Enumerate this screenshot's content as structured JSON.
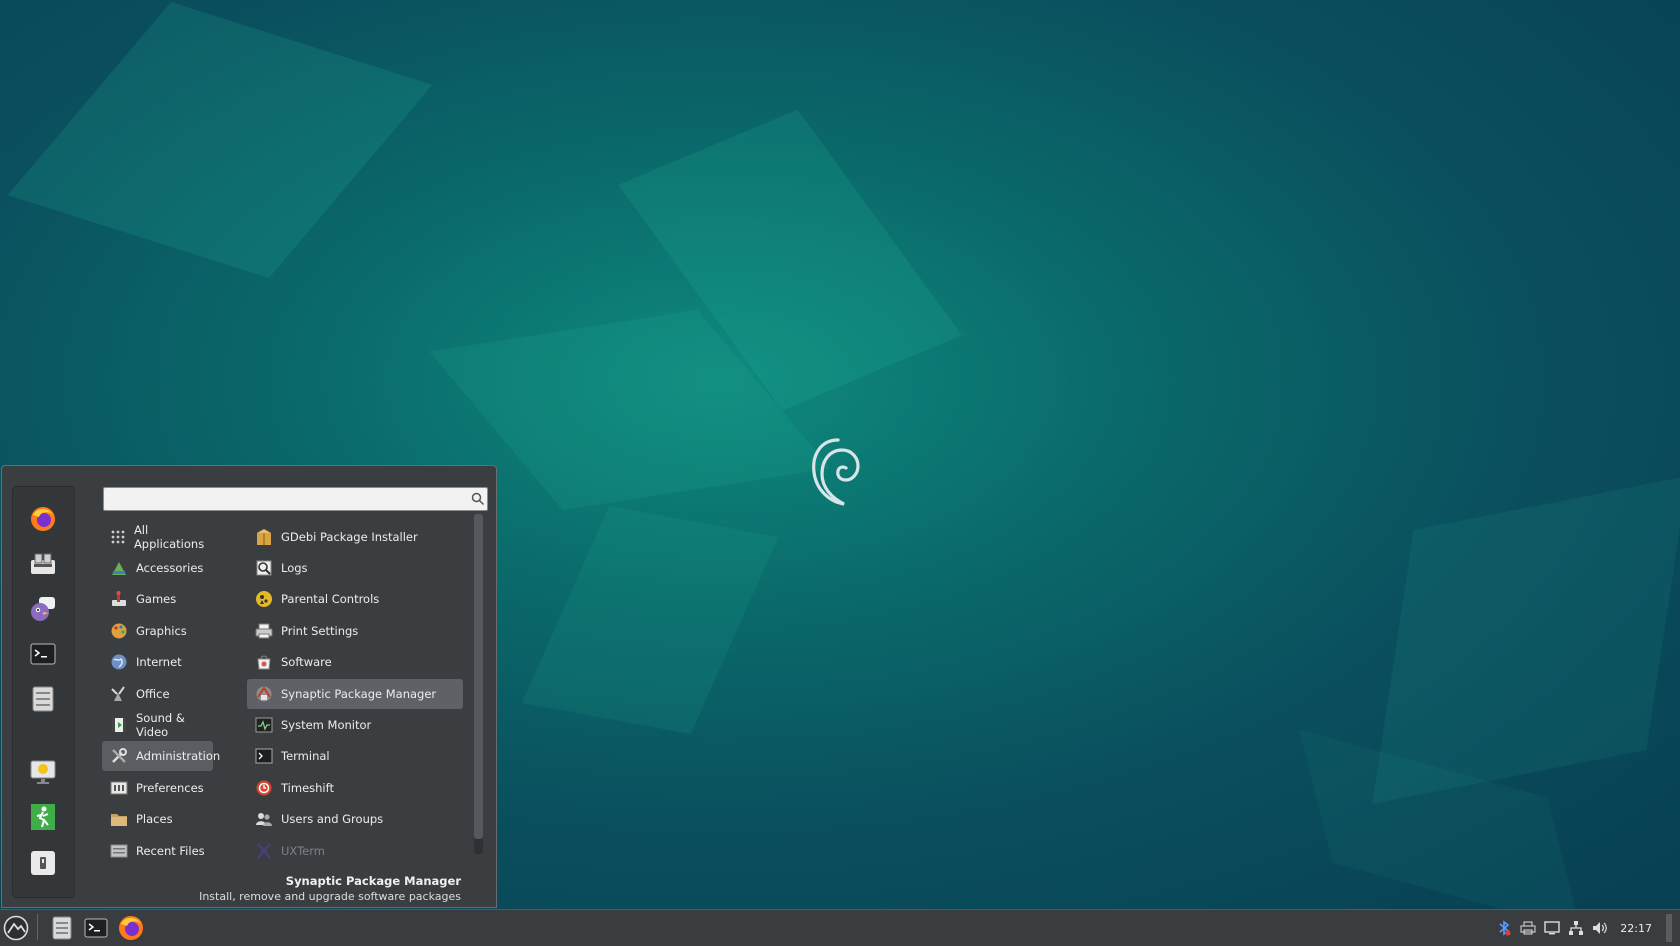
{
  "search": {
    "value": "",
    "placeholder": ""
  },
  "favorites": [
    {
      "name": "firefox-icon"
    },
    {
      "name": "software-manager-icon"
    },
    {
      "name": "pidgin-icon"
    },
    {
      "name": "terminal-icon"
    },
    {
      "name": "file-manager-icon"
    },
    {
      "name": "lock-screen-icon"
    },
    {
      "name": "logout-icon"
    },
    {
      "name": "shutdown-icon"
    }
  ],
  "categories": [
    {
      "label": "All Applications",
      "icon": "grid-icon"
    },
    {
      "label": "Accessories",
      "icon": "accessories-icon"
    },
    {
      "label": "Games",
      "icon": "games-icon"
    },
    {
      "label": "Graphics",
      "icon": "graphics-icon"
    },
    {
      "label": "Internet",
      "icon": "internet-icon"
    },
    {
      "label": "Office",
      "icon": "office-icon"
    },
    {
      "label": "Sound & Video",
      "icon": "sound-video-icon"
    },
    {
      "label": "Administration",
      "icon": "administration-icon"
    },
    {
      "label": "Preferences",
      "icon": "preferences-icon"
    },
    {
      "label": "Places",
      "icon": "folder-icon"
    },
    {
      "label": "Recent Files",
      "icon": "recent-files-icon"
    }
  ],
  "apps": [
    {
      "label": "GDebi Package Installer",
      "icon": "package-icon"
    },
    {
      "label": "Logs",
      "icon": "logs-icon"
    },
    {
      "label": "Parental Controls",
      "icon": "parental-controls-icon"
    },
    {
      "label": "Print Settings",
      "icon": "printer-icon"
    },
    {
      "label": "Software",
      "icon": "software-icon"
    },
    {
      "label": "Synaptic Package Manager",
      "icon": "synaptic-icon"
    },
    {
      "label": "System Monitor",
      "icon": "system-monitor-icon"
    },
    {
      "label": "Terminal",
      "icon": "terminal-icon"
    },
    {
      "label": "Timeshift",
      "icon": "timeshift-icon"
    },
    {
      "label": "Users and Groups",
      "icon": "users-icon"
    },
    {
      "label": "UXTerm",
      "icon": "uxterm-icon"
    }
  ],
  "selected_category": "Administration",
  "selected_app": "Synaptic Package Manager",
  "description": {
    "title": "Synaptic Package Manager",
    "text": "Install, remove and upgrade software packages"
  },
  "taskbar": {
    "clock": "22:17"
  },
  "colors": {
    "desktop": "#0a5a64",
    "menu_bg": "#3b3e41",
    "taskbar_bg": "#3a3d40",
    "highlight": "#5a5e62"
  }
}
